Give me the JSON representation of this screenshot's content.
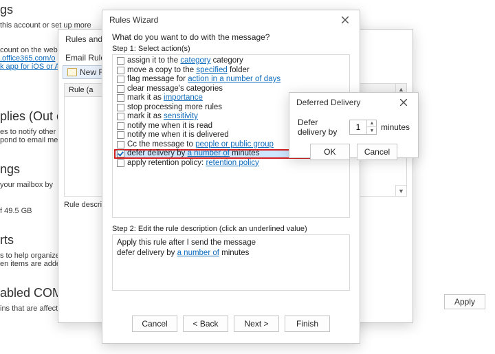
{
  "background": {
    "heading_tail": "gs",
    "sub1": "this account or set up more",
    "sub2a": "count on the web.",
    "link1": ".office365.com/o",
    "link2": "k app for iOS or A",
    "replies_h": "plies (Out c",
    "replies_l1": "es to notify other",
    "replies_l2": "pond to email me",
    "mailbox_h": "ngs",
    "mailbox_l1": "your mailbox by",
    "quota": "f 49.5 GB",
    "alerts_h": "rts",
    "alerts_l1": "s to help organize",
    "alerts_l2": "en items are adde",
    "com_h": "abled COM",
    "com_l1": "ins that are affecting your Out",
    "apply": "Apply"
  },
  "rules_alerts": {
    "title": "Rules and A",
    "tab": "Email Rules",
    "new_rule": "New Ru",
    "rule_col": "Rule (a",
    "desc_label": "Rule descri"
  },
  "wizard": {
    "title": "Rules Wizard",
    "prompt": "What do you want to do with the message?",
    "step1": "Step 1: Select action(s)",
    "actions": [
      {
        "label_pre": "assign it to the ",
        "link": "category",
        "label_post": " category",
        "checked": false
      },
      {
        "label_pre": "move a copy to the ",
        "link": "specified",
        "label_post": " folder",
        "checked": false
      },
      {
        "label_pre": "flag message for ",
        "link": "action in a number of days",
        "label_post": "",
        "checked": false
      },
      {
        "label_pre": "clear message's categories",
        "link": "",
        "label_post": "",
        "checked": false
      },
      {
        "label_pre": "mark it as ",
        "link": "importance",
        "label_post": "",
        "checked": false
      },
      {
        "label_pre": "stop processing more rules",
        "link": "",
        "label_post": "",
        "checked": false
      },
      {
        "label_pre": "mark it as ",
        "link": "sensitivity",
        "label_post": "",
        "checked": false
      },
      {
        "label_pre": "notify me when it is read",
        "link": "",
        "label_post": "",
        "checked": false
      },
      {
        "label_pre": "notify me when it is delivered",
        "link": "",
        "label_post": "",
        "checked": false
      },
      {
        "label_pre": "Cc the message to ",
        "link": "people or public group",
        "label_post": "",
        "checked": false
      },
      {
        "label_pre": "defer delivery by ",
        "link": "a number of",
        "label_post": " minutes",
        "checked": true,
        "selected": true,
        "highlight": true
      },
      {
        "label_pre": "apply retention policy: ",
        "link": "retention policy",
        "label_post": "",
        "checked": false
      }
    ],
    "step2": "Step 2: Edit the rule description (click an underlined value)",
    "desc_line1": "Apply this rule after I send the message",
    "desc_line2_pre": "defer delivery by ",
    "desc_line2_link": "a number of",
    "desc_line2_post": " minutes",
    "btn_cancel": "Cancel",
    "btn_back": "< Back",
    "btn_next": "Next >",
    "btn_finish": "Finish"
  },
  "deferred": {
    "title": "Deferred Delivery",
    "label_pre": "Defer delivery by",
    "value": "1",
    "label_post": "minutes",
    "ok": "OK",
    "cancel": "Cancel"
  }
}
